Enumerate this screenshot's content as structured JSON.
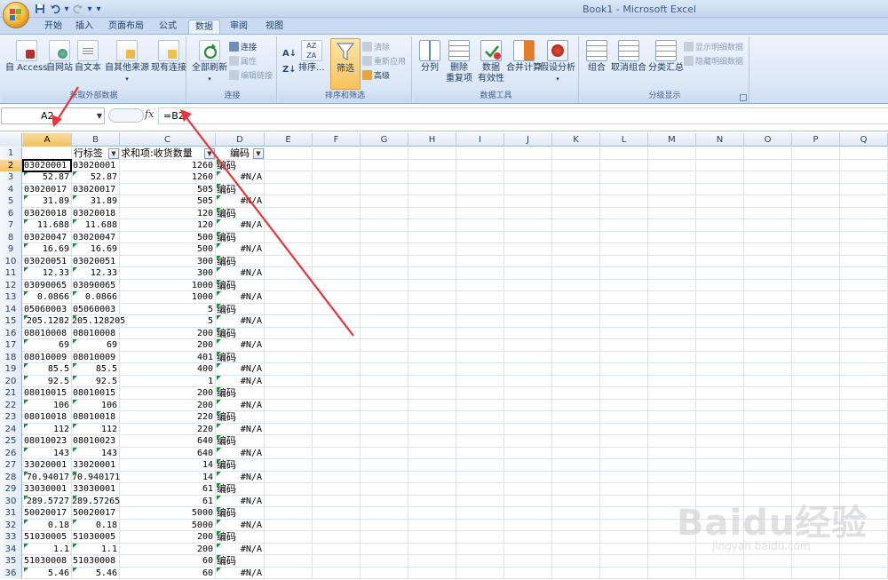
{
  "window": {
    "title": "Book1 - Microsoft Excel"
  },
  "tabs": [
    "开始",
    "插入",
    "页面布局",
    "公式",
    "数据",
    "审阅",
    "视图"
  ],
  "active_tab": "数据",
  "ribbon": {
    "groups": {
      "external": {
        "label": "获取外部数据",
        "buttons": [
          "自 Access",
          "自网站",
          "自文本",
          "自其他来源",
          "现有连接"
        ]
      },
      "connections": {
        "label": "连接",
        "refresh": "全部刷新",
        "small": [
          "连接",
          "属性",
          "编辑链接"
        ]
      },
      "sort": {
        "label": "排序和筛选",
        "sort_btn": "排序...",
        "filter_btn": "筛选",
        "small": [
          "清除",
          "重新应用",
          "高级"
        ]
      },
      "tools": {
        "label": "数据工具",
        "buttons": [
          "分列",
          "删除",
          "数据",
          "合并计算",
          "假设分析"
        ],
        "sub": [
          "重复项",
          "有效性"
        ]
      },
      "outline": {
        "label": "分级显示",
        "buttons": [
          "组合",
          "取消组合",
          "分类汇总"
        ],
        "small": [
          "显示明细数据",
          "隐藏明细数据"
        ]
      }
    }
  },
  "formula_bar": {
    "name_box": "A2",
    "fx": "fx",
    "formula": "=B2"
  },
  "columns": [
    "A",
    "B",
    "C",
    "D",
    "E",
    "F",
    "G",
    "H",
    "I",
    "J",
    "K",
    "L",
    "M",
    "N",
    "O",
    "P",
    "Q"
  ],
  "selected_cell": "A2",
  "rows": [
    {
      "n": "1",
      "a": "",
      "b": "行标签",
      "c": "求和项:收货数量",
      "d": "编码"
    },
    {
      "n": "2",
      "a": "03020001",
      "b": "03020001",
      "c": "1260",
      "d": "编码"
    },
    {
      "n": "3",
      "a": "52.87",
      "b": "52.87",
      "c": "1260",
      "d": "#N/A"
    },
    {
      "n": "4",
      "a": "03020017",
      "b": "03020017",
      "c": "505",
      "d": "编码"
    },
    {
      "n": "5",
      "a": "31.89",
      "b": "31.89",
      "c": "505",
      "d": "#N/A"
    },
    {
      "n": "6",
      "a": "03020018",
      "b": "03020018",
      "c": "120",
      "d": "编码"
    },
    {
      "n": "7",
      "a": "11.688",
      "b": "11.688",
      "c": "120",
      "d": "#N/A"
    },
    {
      "n": "8",
      "a": "03020047",
      "b": "03020047",
      "c": "500",
      "d": "编码"
    },
    {
      "n": "9",
      "a": "16.69",
      "b": "16.69",
      "c": "500",
      "d": "#N/A"
    },
    {
      "n": "10",
      "a": "03020051",
      "b": "03020051",
      "c": "300",
      "d": "编码"
    },
    {
      "n": "11",
      "a": "12.33",
      "b": "12.33",
      "c": "300",
      "d": "#N/A"
    },
    {
      "n": "12",
      "a": "03090065",
      "b": "03090065",
      "c": "1000",
      "d": "编码"
    },
    {
      "n": "13",
      "a": "0.0866",
      "b": "0.0866",
      "c": "1000",
      "d": "#N/A"
    },
    {
      "n": "14",
      "a": "05060003",
      "b": "05060003",
      "c": "5",
      "d": "编码"
    },
    {
      "n": "15",
      "a": "205.1282",
      "b": "205.128205",
      "c": "5",
      "d": "#N/A"
    },
    {
      "n": "16",
      "a": "08010008",
      "b": "08010008",
      "c": "200",
      "d": "编码"
    },
    {
      "n": "17",
      "a": "69",
      "b": "69",
      "c": "200",
      "d": "#N/A"
    },
    {
      "n": "18",
      "a": "08010009",
      "b": "08010009",
      "c": "401",
      "d": "编码"
    },
    {
      "n": "19",
      "a": "85.5",
      "b": "85.5",
      "c": "400",
      "d": "#N/A"
    },
    {
      "n": "20",
      "a": "92.5",
      "b": "92.5",
      "c": "1",
      "d": "#N/A"
    },
    {
      "n": "21",
      "a": "08010015",
      "b": "08010015",
      "c": "200",
      "d": "编码"
    },
    {
      "n": "22",
      "a": "106",
      "b": "106",
      "c": "200",
      "d": "#N/A"
    },
    {
      "n": "23",
      "a": "08010018",
      "b": "08010018",
      "c": "220",
      "d": "编码"
    },
    {
      "n": "24",
      "a": "112",
      "b": "112",
      "c": "220",
      "d": "#N/A"
    },
    {
      "n": "25",
      "a": "08010023",
      "b": "08010023",
      "c": "640",
      "d": "编码"
    },
    {
      "n": "26",
      "a": "143",
      "b": "143",
      "c": "640",
      "d": "#N/A"
    },
    {
      "n": "27",
      "a": "33020001",
      "b": "33020001",
      "c": "14",
      "d": "编码"
    },
    {
      "n": "28",
      "a": "70.94017",
      "b": "70.940171",
      "c": "14",
      "d": "#N/A"
    },
    {
      "n": "29",
      "a": "33030001",
      "b": "33030001",
      "c": "61",
      "d": "编码"
    },
    {
      "n": "30",
      "a": "289.5727",
      "b": "289.57265",
      "c": "61",
      "d": "#N/A"
    },
    {
      "n": "31",
      "a": "50020017",
      "b": "50020017",
      "c": "5000",
      "d": "编码"
    },
    {
      "n": "32",
      "a": "0.18",
      "b": "0.18",
      "c": "5000",
      "d": "#N/A"
    },
    {
      "n": "33",
      "a": "51030005",
      "b": "51030005",
      "c": "200",
      "d": "编码"
    },
    {
      "n": "34",
      "a": "1.1",
      "b": "1.1",
      "c": "200",
      "d": "#N/A"
    },
    {
      "n": "35",
      "a": "51030008",
      "b": "51030008",
      "c": "60",
      "d": "编码"
    },
    {
      "n": "36",
      "a": "5.46",
      "b": "5.46",
      "c": "60",
      "d": "#N/A"
    }
  ],
  "watermark": {
    "text": "Baidu经验",
    "sub": "jingyan.baidu.com"
  },
  "colors": {
    "accent": "#e8343a",
    "ribbon": "#dce8f6",
    "selected_header": "#f1c15f"
  }
}
